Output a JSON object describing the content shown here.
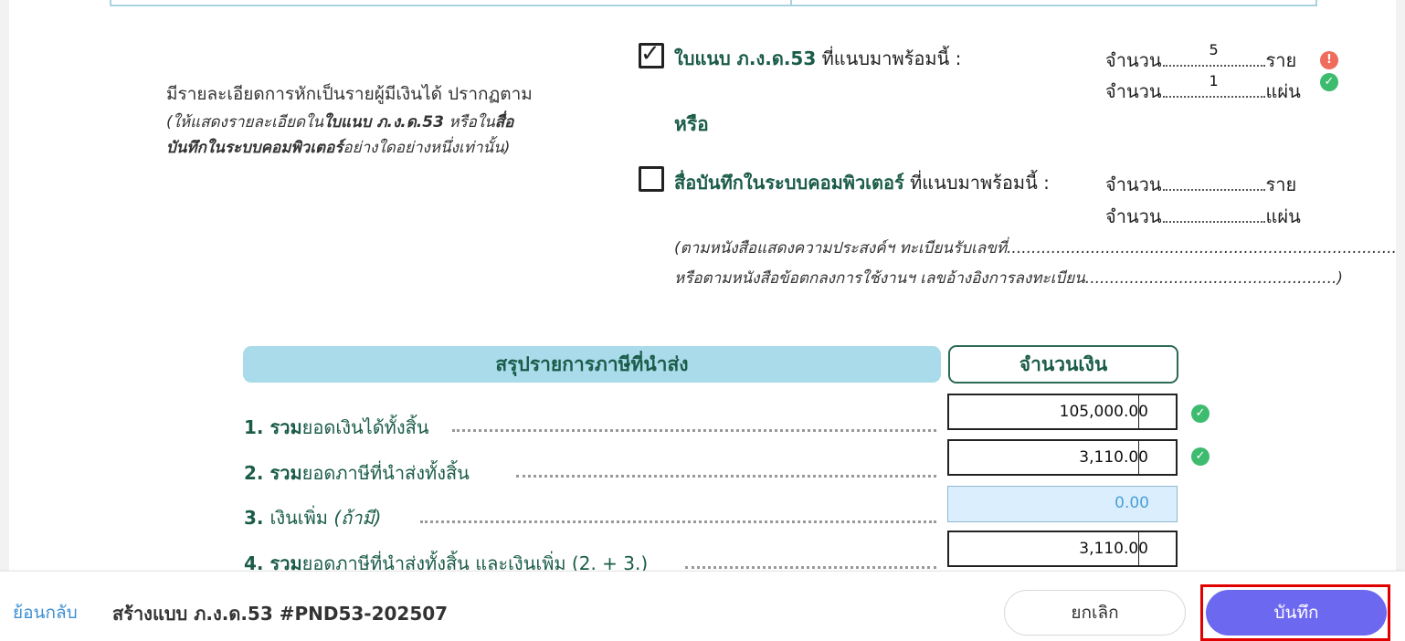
{
  "attachment": {
    "left_note_main": "มีรายละเอียดการหักเป็นรายผู้มีเงินได้ ปรากฏตาม",
    "left_note_line1_a": "(ให้แสดงรายละเอียดใน",
    "left_note_line1_b": "ใบแนบ ภ.ง.ด.53",
    "left_note_line1_c": " หรือใน",
    "left_note_line1_d": "สื่อ",
    "left_note_line2_a": "บันทึกในระบบคอมพิวเตอร์",
    "left_note_line2_b": "อย่างใดอย่างหนึ่งเท่านั้น)",
    "option1_bold": "ใบแนบ ภ.ง.ด.53",
    "option1_rest": " ที่แนบมาพร้อมนี้ :",
    "option1_checked": true,
    "option1_count_prefix": "จำนวน",
    "option1_count_value": "5",
    "option1_count_unit": "ราย",
    "option1_sheets_prefix": "จำนวน",
    "option1_sheets_value": "1",
    "option1_sheets_unit": "แผ่น",
    "or_label": "หรือ",
    "option2_bold": "สื่อบันทึกในระบบคอมพิวเตอร์",
    "option2_rest": " ที่แนบมาพร้อมนี้ :",
    "option2_checked": false,
    "option2_count_prefix": "จำนวน",
    "option2_count_unit": "ราย",
    "option2_sheets_prefix": "จำนวน",
    "option2_sheets_unit": "แผ่น",
    "italic_line1": "(ตามหนังสือแสดงความประสงค์ฯ ทะเบียนรับเลขที่.......................................................................................",
    "italic_line2": "หรือตามหนังสือข้อตกลงการใช้งานฯ เลขอ้างอิงการลงทะเบียน...................................................)"
  },
  "summary": {
    "title": "สรุปรายการภาษีที่นำส่ง",
    "amount_header": "จำนวนเงิน",
    "rows": [
      {
        "num": "1. ",
        "bold": "รวม",
        "rest": "ยอดเงินได้ทั้งสิ้น",
        "value": "105,000.00",
        "status": "ok"
      },
      {
        "num": "2. ",
        "bold": "รวม",
        "rest": "ยอดภาษีที่นำส่งทั้งสิ้น",
        "value": "3,110.00",
        "status": "ok"
      },
      {
        "num": "3. ",
        "bold": "",
        "rest": "เงินเพิ่ม ",
        "italic": "(ถ้ามี)",
        "value": "0.00",
        "status": ""
      },
      {
        "num": "4. ",
        "bold": "รวม",
        "rest": "ยอดภาษีที่นำส่งทั้งสิ้น และเงินเพิ่ม (2. + 3.)",
        "value": "3,110.00",
        "status": ""
      }
    ]
  },
  "footer": {
    "back_label": "ย้อนกลับ",
    "title": "สร้างแบบ ภ.ง.ด.53 #PND53-202507",
    "cancel_label": "ยกเลิก",
    "save_label": "บันทึก"
  },
  "colors": {
    "accent": "#6d68f0",
    "ok": "#3dbb6e",
    "warn": "#ef6b5b",
    "link": "#3d8fd3",
    "form_green": "#1b5c49",
    "header_blue": "#a9dbeb"
  }
}
